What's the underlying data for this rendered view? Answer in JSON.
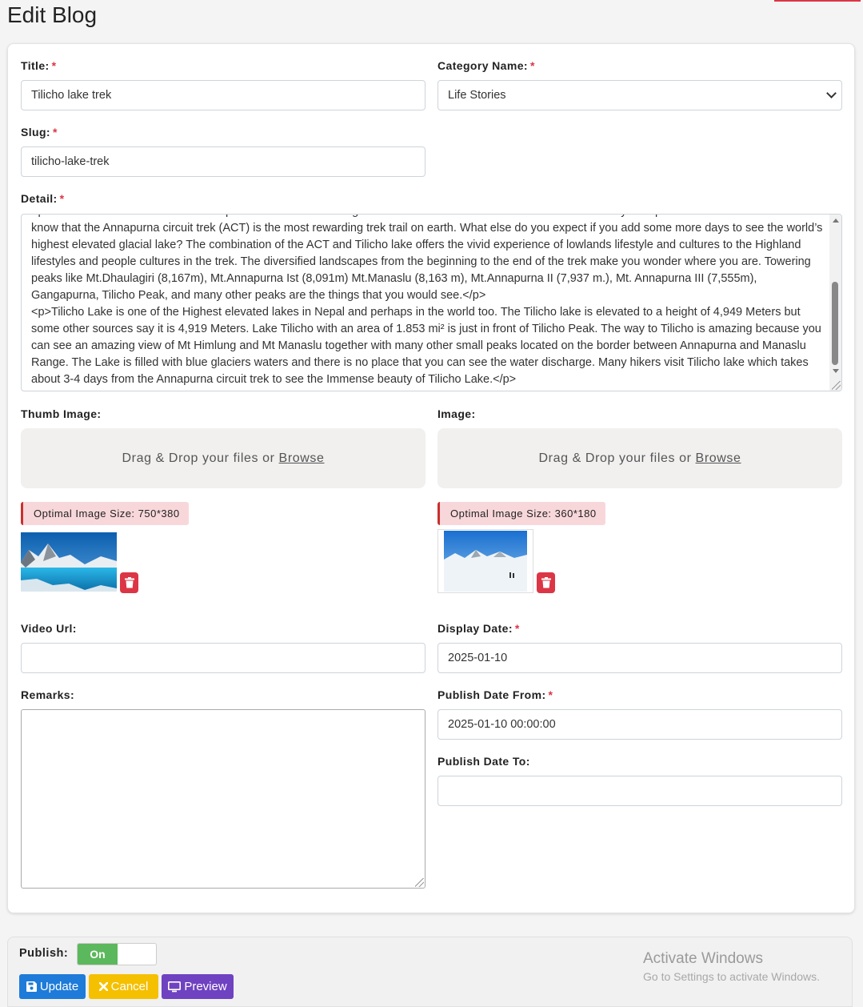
{
  "page": {
    "title": "Edit Blog"
  },
  "form": {
    "title": {
      "label": "Title:",
      "value": "Tilicho lake trek"
    },
    "category": {
      "label": "Category Name:",
      "value": "Life Stories"
    },
    "slug": {
      "label": "Slug:",
      "value": "tilicho-lake-trek"
    },
    "detail": {
      "label": "Detail:",
      "value": "<p>What to see on tilicho lake trek?</p> There are a lot of things to see on the Tilicho lake trek which is more than you expect. Most of the trekkers don’t know that the Annapurna circuit trek (ACT) is the most rewarding trek trail on earth. What else do you expect if you add some more days to see the world’s highest elevated glacial lake? The combination of the ACT and Tilicho lake offers the vivid experience of lowlands lifestyle and cultures to the Highland lifestyles and people cultures in the trek. The diversified landscapes from the beginning to the end of the trek make you wonder where you are. Towering peaks like Mt.Dhaulagiri (8,167m), Mt.Annapurna Ist (8,091m) Mt.Manaslu (8,163 m), Mt.Annapurna II (7,937 m.), Mt. Annapurna III (7,555m), Gangapurna, Tilicho Peak, and many other peaks are the things that you would see.</p>\n<p>Tilicho Lake is one of the Highest elevated lakes in Nepal and perhaps in the world too. The Tilicho lake is elevated to a height of 4,949 Meters but some other sources say it is 4,919 Meters. Lake Tilicho with an area of 1.853 mi² is just in front of Tilicho Peak. The way to Tilicho is amazing because you can see an amazing view of Mt Himlung and Mt Manaslu together with many other small peaks located on the border between Annapurna and Manaslu Range. The Lake is filled with blue glaciers waters and there is no place that you can see the water discharge. Many hikers visit Tilicho lake which takes about 3-4 days from the Annapurna circuit trek to see the Immense beauty of Tilicho Lake.</p>"
    },
    "thumb_image": {
      "label": "Thumb Image:",
      "drop_text": "Drag & Drop your files or",
      "browse": "Browse",
      "size_note": "Optimal Image Size: 750*380"
    },
    "image": {
      "label": "Image:",
      "drop_text": "Drag & Drop your files or",
      "browse": "Browse",
      "size_note": "Optimal Image Size: 360*180"
    },
    "video_url": {
      "label": "Video Url:",
      "value": ""
    },
    "display_date": {
      "label": "Display Date:",
      "value": "2025-01-10"
    },
    "remarks": {
      "label": "Remarks:",
      "value": ""
    },
    "publish_from": {
      "label": "Publish Date From:",
      "value": "2025-01-10 00:00:00"
    },
    "publish_to": {
      "label": "Publish Date To:",
      "value": ""
    },
    "required_mark": "*"
  },
  "footer": {
    "publish_label": "Publish:",
    "toggle_state": "On",
    "update": "Update",
    "cancel": "Cancel",
    "preview": "Preview"
  },
  "watermark": {
    "title": "Activate Windows",
    "subtitle": "Go to Settings to activate Windows."
  },
  "colors": {
    "required": "#dc3545",
    "update": "#1e7bd9",
    "cancel": "#f5c000",
    "preview": "#6f42c1",
    "toggle_on": "#5cb85c",
    "delete": "#dc3545"
  },
  "icons": [
    "trash-icon",
    "save-icon",
    "close-icon",
    "monitor-icon",
    "select-chevron-icon"
  ]
}
